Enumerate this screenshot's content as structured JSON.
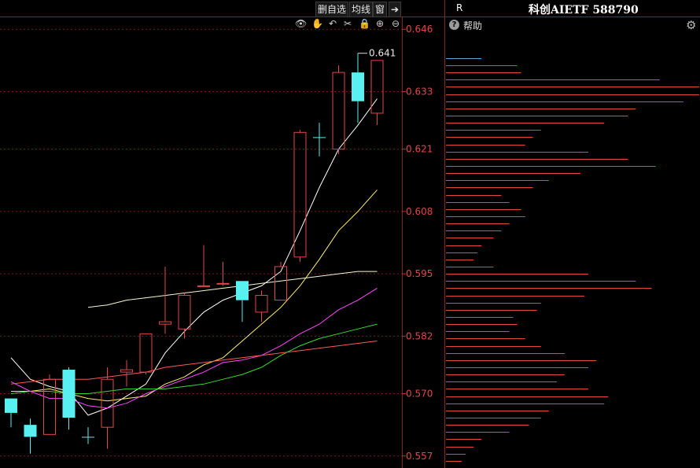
{
  "header": {
    "title": "科创AIETF 588790",
    "right_flag": "R",
    "buttons": {
      "delete_watch": "删自选",
      "ma_lines": "均线",
      "window": "窗",
      "exit": "➔"
    }
  },
  "side_panel": {
    "help_label": "帮助"
  },
  "toolbar_icons": [
    "eye-icon",
    "hand-icon",
    "undo-icon",
    "scissors-icon",
    "lock-icon",
    "zoom-in-icon",
    "zoom-out-icon"
  ],
  "chart_data": {
    "type": "candlestick",
    "y_ticks": [
      "0.646",
      "0.633",
      "0.621",
      "0.608",
      "0.595",
      "0.582",
      "0.570",
      "0.557"
    ],
    "ylim": [
      0.5545,
      0.6485
    ],
    "annotation": {
      "label": "0.641",
      "value": 0.641
    },
    "up_color": "#e04848",
    "down_color": "#58f0f0",
    "candles": [
      {
        "open": 0.569,
        "high": 0.5685,
        "low": 0.563,
        "close": 0.566,
        "bearish": true
      },
      {
        "open": 0.5635,
        "high": 0.5648,
        "low": 0.5575,
        "close": 0.561,
        "bearish": true
      },
      {
        "open": 0.5615,
        "high": 0.574,
        "low": 0.5615,
        "close": 0.573,
        "bearish": false
      },
      {
        "open": 0.575,
        "high": 0.5755,
        "low": 0.5625,
        "close": 0.565,
        "bearish": true
      },
      {
        "open": 0.561,
        "high": 0.563,
        "low": 0.5595,
        "close": 0.561,
        "bearish": true
      },
      {
        "open": 0.563,
        "high": 0.5755,
        "low": 0.5585,
        "close": 0.573,
        "bearish": false
      },
      {
        "open": 0.5745,
        "high": 0.577,
        "low": 0.5715,
        "close": 0.575,
        "bearish": false
      },
      {
        "open": 0.5745,
        "high": 0.5825,
        "low": 0.574,
        "close": 0.5825,
        "bearish": false
      },
      {
        "open": 0.5845,
        "high": 0.5965,
        "low": 0.5825,
        "close": 0.585,
        "bearish": false
      },
      {
        "open": 0.5835,
        "high": 0.591,
        "low": 0.5815,
        "close": 0.5905,
        "bearish": false
      },
      {
        "open": 0.5925,
        "high": 0.601,
        "low": 0.5925,
        "close": 0.5925,
        "bearish": false
      },
      {
        "open": 0.593,
        "high": 0.5975,
        "low": 0.5925,
        "close": 0.593,
        "bearish": false
      },
      {
        "open": 0.5935,
        "high": 0.5935,
        "low": 0.585,
        "close": 0.5895,
        "bearish": true
      },
      {
        "open": 0.587,
        "high": 0.5915,
        "low": 0.585,
        "close": 0.5905,
        "bearish": false
      },
      {
        "open": 0.5895,
        "high": 0.5975,
        "low": 0.5895,
        "close": 0.5965,
        "bearish": false
      },
      {
        "open": 0.5985,
        "high": 0.625,
        "low": 0.5975,
        "close": 0.6245,
        "bearish": false
      },
      {
        "open": 0.6235,
        "high": 0.6265,
        "low": 0.6195,
        "close": 0.6235,
        "bearish": true
      },
      {
        "open": 0.621,
        "high": 0.6385,
        "low": 0.62,
        "close": 0.637,
        "bearish": false
      },
      {
        "open": 0.637,
        "high": 0.641,
        "low": 0.6265,
        "close": 0.631,
        "bearish": true
      },
      {
        "open": 0.6285,
        "high": 0.6395,
        "low": 0.626,
        "close": 0.6395,
        "bearish": false
      }
    ],
    "ma_lines": [
      {
        "color": "#ffffff",
        "points": [
          [
            0,
            0.5775
          ],
          [
            1,
            0.573
          ],
          [
            2,
            0.5715
          ],
          [
            3,
            0.5705
          ],
          [
            4,
            0.5655
          ],
          [
            5,
            0.567
          ],
          [
            6,
            0.5695
          ],
          [
            7,
            0.572
          ],
          [
            8,
            0.5785
          ],
          [
            9,
            0.583
          ],
          [
            10,
            0.587
          ],
          [
            11,
            0.5895
          ],
          [
            12,
            0.591
          ],
          [
            13,
            0.5925
          ],
          [
            14,
            0.5955
          ],
          [
            15,
            0.604
          ],
          [
            16,
            0.613
          ],
          [
            17,
            0.621
          ],
          [
            18,
            0.626
          ],
          [
            19,
            0.6315
          ]
        ]
      },
      {
        "color": "#ffee66",
        "points": [
          [
            0,
            0.5705
          ],
          [
            1,
            0.5705
          ],
          [
            2,
            0.571
          ],
          [
            3,
            0.57
          ],
          [
            4,
            0.569
          ],
          [
            5,
            0.5685
          ],
          [
            6,
            0.569
          ],
          [
            7,
            0.5695
          ],
          [
            8,
            0.572
          ],
          [
            9,
            0.5735
          ],
          [
            10,
            0.576
          ],
          [
            11,
            0.5775
          ],
          [
            12,
            0.581
          ],
          [
            13,
            0.5845
          ],
          [
            14,
            0.588
          ],
          [
            15,
            0.5925
          ],
          [
            16,
            0.598
          ],
          [
            17,
            0.604
          ],
          [
            18,
            0.608
          ],
          [
            19,
            0.6125
          ]
        ]
      },
      {
        "color": "#ff44ff",
        "points": [
          [
            0,
            0.5725
          ],
          [
            1,
            0.5705
          ],
          [
            2,
            0.569
          ],
          [
            3,
            0.569
          ],
          [
            4,
            0.5675
          ],
          [
            5,
            0.567
          ],
          [
            6,
            0.568
          ],
          [
            7,
            0.57
          ],
          [
            8,
            0.5715
          ],
          [
            9,
            0.573
          ],
          [
            10,
            0.5745
          ],
          [
            11,
            0.5765
          ],
          [
            12,
            0.577
          ],
          [
            13,
            0.578
          ],
          [
            14,
            0.58
          ],
          [
            15,
            0.5825
          ],
          [
            16,
            0.5845
          ],
          [
            17,
            0.5875
          ],
          [
            18,
            0.5895
          ],
          [
            19,
            0.592
          ]
        ]
      },
      {
        "color": "#33dd33",
        "points": [
          [
            0,
            0.57
          ],
          [
            1,
            0.5705
          ],
          [
            2,
            0.5705
          ],
          [
            3,
            0.57
          ],
          [
            4,
            0.57
          ],
          [
            5,
            0.5705
          ],
          [
            6,
            0.571
          ],
          [
            7,
            0.571
          ],
          [
            8,
            0.571
          ],
          [
            9,
            0.5715
          ],
          [
            10,
            0.572
          ],
          [
            11,
            0.573
          ],
          [
            12,
            0.574
          ],
          [
            13,
            0.5755
          ],
          [
            14,
            0.578
          ],
          [
            15,
            0.58
          ],
          [
            16,
            0.5815
          ],
          [
            17,
            0.5825
          ],
          [
            18,
            0.5835
          ],
          [
            19,
            0.5845
          ]
        ]
      },
      {
        "color": "#ff5555",
        "points": [
          [
            0,
            0.572
          ],
          [
            1,
            0.5725
          ],
          [
            2,
            0.573
          ],
          [
            3,
            0.573
          ],
          [
            4,
            0.573
          ],
          [
            5,
            0.5735
          ],
          [
            6,
            0.574
          ],
          [
            7,
            0.5745
          ],
          [
            8,
            0.5755
          ],
          [
            9,
            0.576
          ],
          [
            10,
            0.5765
          ],
          [
            11,
            0.577
          ],
          [
            12,
            0.5775
          ],
          [
            13,
            0.578
          ],
          [
            14,
            0.5785
          ],
          [
            15,
            0.579
          ],
          [
            16,
            0.5795
          ],
          [
            17,
            0.58
          ],
          [
            18,
            0.5805
          ],
          [
            19,
            0.581
          ]
        ]
      },
      {
        "color": "#f8f8d0",
        "points": [
          [
            4,
            0.588
          ],
          [
            5,
            0.5885
          ],
          [
            6,
            0.5895
          ],
          [
            7,
            0.59
          ],
          [
            8,
            0.5905
          ],
          [
            9,
            0.591
          ],
          [
            10,
            0.5915
          ],
          [
            11,
            0.592
          ],
          [
            12,
            0.5925
          ],
          [
            13,
            0.593
          ],
          [
            14,
            0.5935
          ],
          [
            15,
            0.594
          ],
          [
            16,
            0.5945
          ],
          [
            17,
            0.595
          ],
          [
            18,
            0.5955
          ],
          [
            19,
            0.5955
          ]
        ]
      }
    ],
    "volume_profile": {
      "bins": [
        0.64,
        0.6385,
        0.637,
        0.6355,
        0.634,
        0.6325,
        0.631,
        0.6295,
        0.628,
        0.6265,
        0.625,
        0.6235,
        0.622,
        0.6205,
        0.619,
        0.6175,
        0.616,
        0.6145,
        0.613,
        0.6115,
        0.61,
        0.6085,
        0.607,
        0.6055,
        0.604,
        0.6025,
        0.601,
        0.5995,
        0.598,
        0.5965,
        0.595,
        0.5935,
        0.592,
        0.5905,
        0.589,
        0.5875,
        0.586,
        0.5845,
        0.583,
        0.5815,
        0.58,
        0.5785,
        0.577,
        0.5755,
        0.574,
        0.5725,
        0.571,
        0.5695,
        0.568,
        0.5665,
        0.565,
        0.5635,
        0.562,
        0.5605,
        0.559,
        0.5575,
        0.556
      ],
      "values": [
        45,
        90,
        95,
        270,
        320,
        320,
        300,
        240,
        230,
        200,
        120,
        110,
        100,
        180,
        230,
        265,
        170,
        130,
        110,
        70,
        80,
        95,
        100,
        80,
        70,
        60,
        45,
        40,
        35,
        60,
        180,
        240,
        260,
        175,
        120,
        115,
        85,
        90,
        80,
        100,
        120,
        150,
        190,
        180,
        150,
        140,
        180,
        205,
        200,
        130,
        120,
        105,
        80,
        45,
        35,
        25,
        20
      ],
      "cyan_bins": [
        0.64,
        0.5975
      ]
    }
  }
}
